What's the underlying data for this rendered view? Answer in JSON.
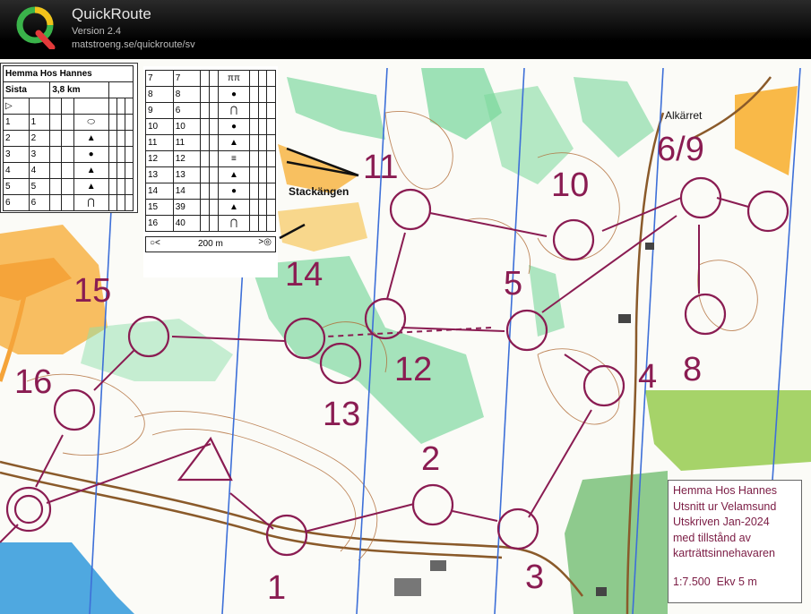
{
  "app": {
    "title": "QuickRoute",
    "version": "Version 2.4",
    "url": "matstroeng.se/quickroute/sv"
  },
  "description_sheet": {
    "event": "Hemma Hos Hannes",
    "class": "Sista",
    "length": "3,8 km",
    "start_symbol": "▷",
    "rows_left": [
      {
        "no": "1",
        "code": "1",
        "symbol": "oval"
      },
      {
        "no": "2",
        "code": "2",
        "symbol": "triangle"
      },
      {
        "no": "3",
        "code": "3",
        "symbol": "dot"
      },
      {
        "no": "4",
        "code": "4",
        "symbol": "triangle"
      },
      {
        "no": "5",
        "code": "5",
        "symbol": "triangle"
      },
      {
        "no": "6",
        "code": "6",
        "symbol": "arch"
      }
    ],
    "rows_right": [
      {
        "no": "7",
        "code": "7",
        "symbol": "fence"
      },
      {
        "no": "8",
        "code": "8",
        "symbol": "dot"
      },
      {
        "no": "9",
        "code": "6",
        "symbol": "arch"
      },
      {
        "no": "10",
        "code": "10",
        "symbol": "dot"
      },
      {
        "no": "11",
        "code": "11",
        "symbol": "triangle"
      },
      {
        "no": "12",
        "code": "12",
        "symbol": "lines"
      },
      {
        "no": "13",
        "code": "13",
        "symbol": "triangle"
      },
      {
        "no": "14",
        "code": "14",
        "symbol": "dot"
      },
      {
        "no": "15",
        "code": "39",
        "symbol": "triangle"
      },
      {
        "no": "16",
        "code": "40",
        "symbol": "arch"
      }
    ],
    "finish_distance": "200 m"
  },
  "place_names": {
    "alkarret": "Alkärret",
    "stackangen": "Stackängen"
  },
  "controls": [
    {
      "label": "1"
    },
    {
      "label": "2"
    },
    {
      "label": "3"
    },
    {
      "label": "4"
    },
    {
      "label": "5"
    },
    {
      "label": "6/9"
    },
    {
      "label": "8"
    },
    {
      "label": "10"
    },
    {
      "label": "11"
    },
    {
      "label": "12"
    },
    {
      "label": "13"
    },
    {
      "label": "14"
    },
    {
      "label": "15"
    },
    {
      "label": "16"
    }
  ],
  "info_box": {
    "line1": "Hemma Hos Hannes",
    "line2": "Utsnitt ur Velamsund",
    "line3": "Utskriven Jan-2024",
    "line4": "med tillstånd av",
    "line5": "karträttsinnehavaren",
    "scale": "1:7.500",
    "equidistance": "Ekv 5 m"
  },
  "colors": {
    "course": "#8a1c52",
    "vegetation_green": "#3fbf6c",
    "open_land": "#f7b347",
    "water": "#4fa8e0",
    "north_lines": "#3d6fd8",
    "contours": "#b06a35"
  }
}
